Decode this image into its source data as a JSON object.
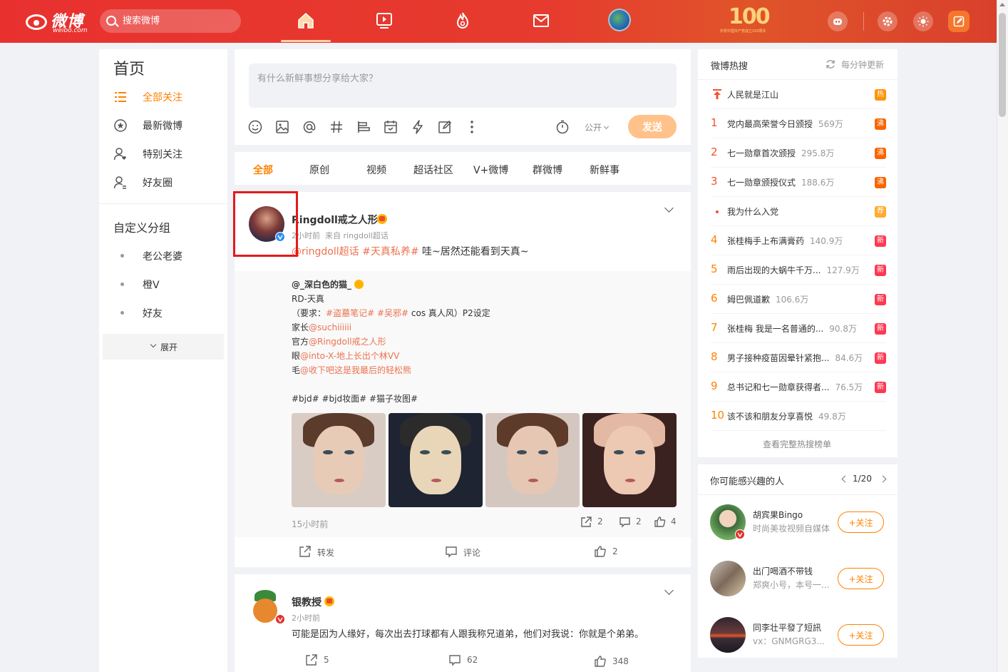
{
  "header": {
    "logo_text": "微博",
    "logo_domain": "weibo.com",
    "search_placeholder": "搜索微博",
    "centennial_text": "100",
    "centennial_caption": "庆祝中国共产党成立100周年"
  },
  "left_nav": {
    "title": "首页",
    "items": [
      {
        "label": "全部关注",
        "icon": "list-icon",
        "active": true
      },
      {
        "label": "最新微博",
        "icon": "star-circle-icon",
        "active": false
      },
      {
        "label": "特别关注",
        "icon": "user-heart-icon",
        "active": false
      },
      {
        "label": "好友圈",
        "icon": "user-friends-icon",
        "active": false
      }
    ],
    "custom_groups_title": "自定义分组",
    "groups": [
      "老公老婆",
      "橙V",
      "好友"
    ],
    "expand_label": "展开"
  },
  "publisher": {
    "placeholder": "有什么新鲜事想分享给大家？",
    "visibility": "公开",
    "send_label": "发送"
  },
  "tabs": [
    "全部",
    "原创",
    "视频",
    "超话社区",
    "V+微博",
    "群微博",
    "新鲜事"
  ],
  "feed": [
    {
      "username": "Ringdoll戒之人形",
      "time": "2小时前",
      "source": "来自 ringdoll超话",
      "text_links": [
        "@ringdoll超话",
        "#天真私养#"
      ],
      "text_plain": " 哇~居然还能看到天真~",
      "repost": {
        "author": "@_深白色的猫_",
        "line1": "RD-天真",
        "line2_prefix": "（要求：",
        "line2_links": [
          "#盗墓笔记#",
          "#吴邪#"
        ],
        "line2_suffix": " cos 真人风）P2设定",
        "line3_prefix": "家长",
        "line3_link": "@suchiiiiii",
        "line4_prefix": "官方",
        "line4_link": "@Ringdoll戒之人形",
        "line5_prefix": "眼",
        "line5_link": "@into-X-地上长出个林VV",
        "line6_prefix": "毛",
        "line6_link": "@收下吧这是我最后的轻松熊",
        "tags": "#bjd# #bjd妆面# #猫子妆图#",
        "time": "15小时前",
        "reposts": "2",
        "comments": "2",
        "likes": "4"
      },
      "actions": {
        "repost_label": "转发",
        "comment_label": "评论",
        "likes": "2"
      }
    },
    {
      "username": "银教授",
      "time": "2小时前",
      "text": "可能是因为人缘好，每次出去打球都有人跟我称兄道弟，他们对我说：你就是个弟弟。",
      "reposts": "5",
      "comments": "62",
      "likes": "348"
    }
  ],
  "hot_search": {
    "title": "微博热搜",
    "refresh_label": "每分钟更新",
    "items": [
      {
        "rank": "",
        "topic": "人民就是江山",
        "count": "",
        "tag": "热",
        "tag_color": "#ff9406"
      },
      {
        "rank": "1",
        "topic": "党内最高荣誉今日颁授",
        "count": "569万",
        "tag": "沸",
        "tag_color": "#f86400"
      },
      {
        "rank": "2",
        "topic": "七一勋章首次颁授",
        "count": "295.8万",
        "tag": "沸",
        "tag_color": "#f86400"
      },
      {
        "rank": "3",
        "topic": "七一勋章颁授仪式",
        "count": "188.6万",
        "tag": "沸",
        "tag_color": "#f86400"
      },
      {
        "rank": "",
        "topic": "我为什么入党",
        "count": "",
        "tag": "荐",
        "tag_color": "#ffab2d"
      },
      {
        "rank": "4",
        "topic": "张桂梅手上布满膏药",
        "count": "140.9万",
        "tag": "新",
        "tag_color": "#ff3852"
      },
      {
        "rank": "5",
        "topic": "雨后出现的大蜗牛千万...",
        "count": "127.9万",
        "tag": "新",
        "tag_color": "#ff3852"
      },
      {
        "rank": "6",
        "topic": "姆巴佩道歉",
        "count": "106.6万",
        "tag": "新",
        "tag_color": "#ff3852"
      },
      {
        "rank": "7",
        "topic": "张桂梅 我是一名普通的...",
        "count": "90.8万",
        "tag": "新",
        "tag_color": "#ff3852"
      },
      {
        "rank": "8",
        "topic": "男子接种疫苗因晕针紧抱...",
        "count": "84.6万",
        "tag": "新",
        "tag_color": "#ff3852"
      },
      {
        "rank": "9",
        "topic": "总书记和七一勋章获得者...",
        "count": "76.5万",
        "tag": "新",
        "tag_color": "#ff3852"
      },
      {
        "rank": "10",
        "topic": "该不该和朋友分享喜悦",
        "count": "49.8万",
        "tag": "",
        "tag_color": ""
      }
    ],
    "full_list_label": "查看完整热搜榜单"
  },
  "suggestions": {
    "title": "你可能感兴趣的人",
    "page": "1/20",
    "follow_label": "+关注",
    "users": [
      {
        "name": "胡宾果Bingo",
        "desc": "时尚美妆视频自媒体"
      },
      {
        "name": "出门喝酒不带钱",
        "desc": "郑爽小号，本号一..."
      },
      {
        "name": "同李壮平發了短訊",
        "desc": "vx：GNMGRG3..."
      }
    ]
  },
  "colors": {
    "brand_red": "#e8312f",
    "accent_orange": "#ff8200",
    "link": "#eb7350",
    "highlight_box": "#e5191b"
  }
}
